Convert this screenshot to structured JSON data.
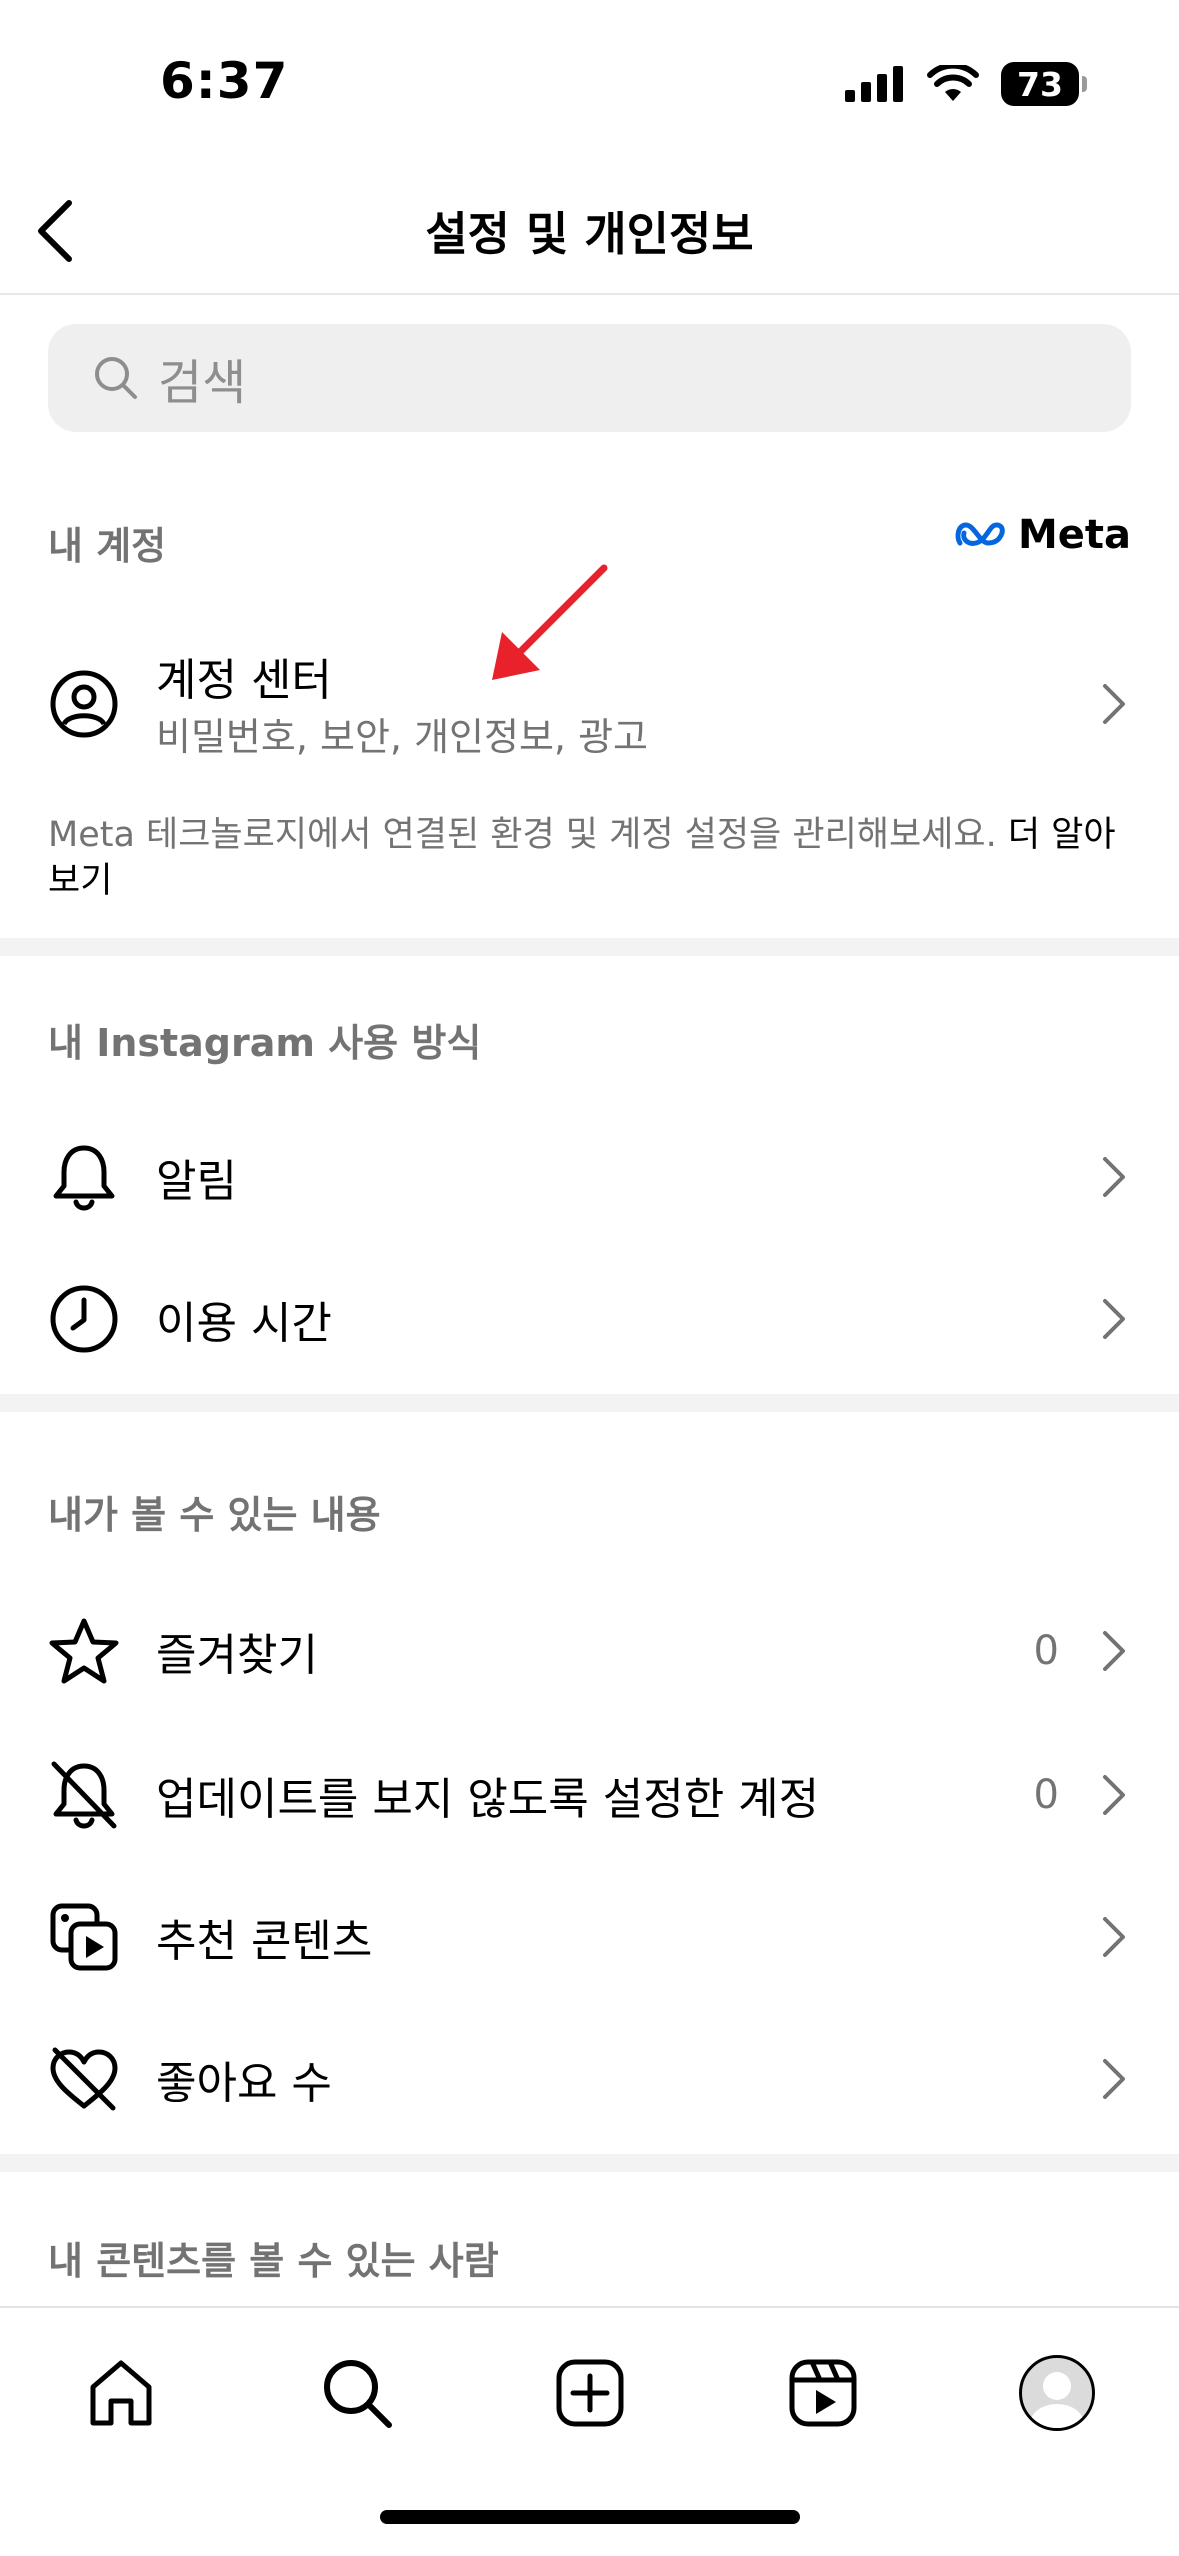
{
  "status_bar": {
    "time": "6:37",
    "battery": "73"
  },
  "header": {
    "title": "설정 및 개인정보"
  },
  "search": {
    "placeholder": "검색"
  },
  "section_account": {
    "label": "내 계정",
    "meta_logo": "Meta",
    "account_center": {
      "title": "계정 센터",
      "subtitle": "비밀번호, 보안, 개인정보, 광고"
    },
    "description": "Meta 테크놀로지에서 연결된 환경 및 계정 설정을 관리해보세요. ",
    "learn_more": "더 알아보기"
  },
  "section_usage": {
    "label": "내 Instagram 사용 방식",
    "items": [
      {
        "label": "알림"
      },
      {
        "label": "이용 시간"
      }
    ]
  },
  "section_content": {
    "label": "내가 볼 수 있는 내용",
    "items": [
      {
        "label": "즐겨찾기",
        "count": "0"
      },
      {
        "label": "업데이트를 보지 않도록 설정한 계정",
        "count": "0"
      },
      {
        "label": "추천 콘텐츠"
      },
      {
        "label": "좋아요 수"
      }
    ]
  },
  "section_visibility": {
    "label": "내 콘텐츠를 볼 수 있는 사람"
  },
  "colors": {
    "annotation_arrow": "#e8212b",
    "meta_blue": "#0467df",
    "secondary_text": "#737373"
  },
  "icons": [
    "back-icon",
    "search-icon",
    "account-circle-icon",
    "bell-icon",
    "clock-icon",
    "star-icon",
    "muted-bell-icon",
    "suggested-media-icon",
    "heart-slash-icon",
    "chevron-right-icon",
    "home-icon",
    "search-nav-icon",
    "create-icon",
    "reels-icon",
    "profile-avatar"
  ]
}
